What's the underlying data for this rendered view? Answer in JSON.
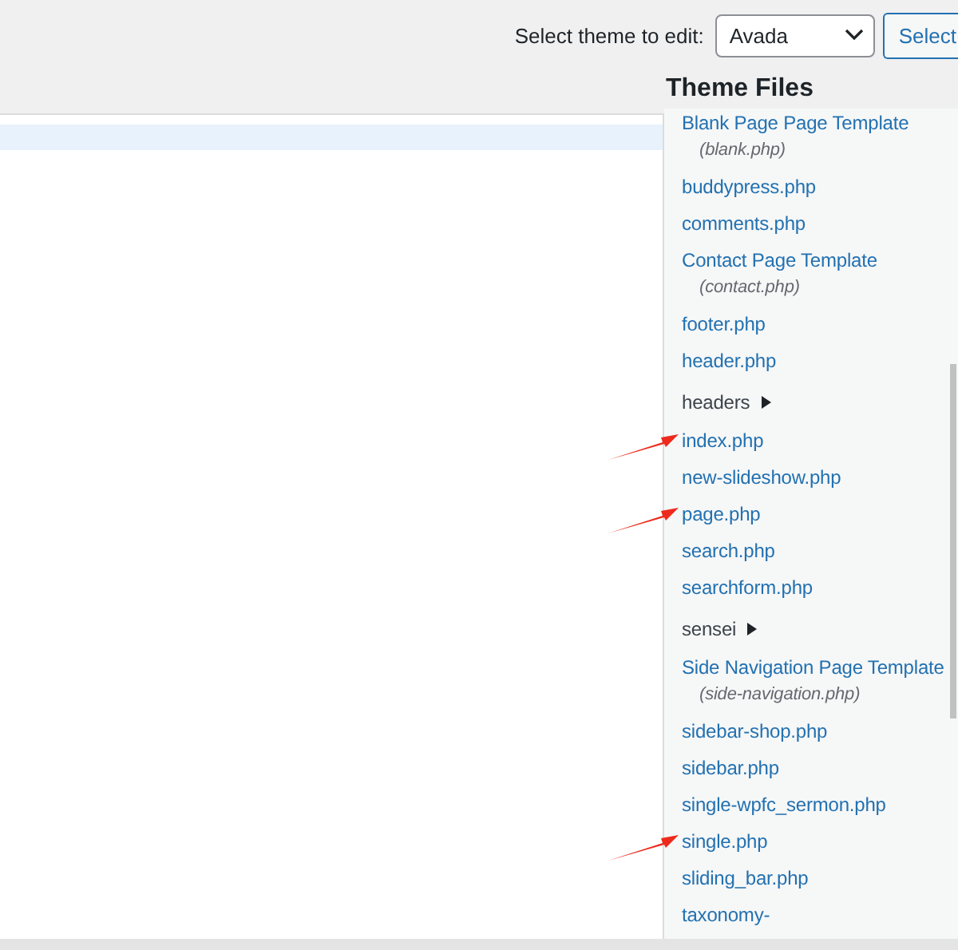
{
  "theme_selector": {
    "label": "Select theme to edit:",
    "value": "Avada",
    "button": "Select"
  },
  "editor": {
    "highlighted_line": true
  },
  "theme_files": {
    "title": "Theme Files",
    "items": [
      {
        "kind": "template",
        "name": "Blank Page Page Template",
        "file": "(blank.php)",
        "marked": false
      },
      {
        "kind": "file",
        "name": "buddypress.php",
        "marked": false
      },
      {
        "kind": "file",
        "name": "comments.php",
        "marked": false
      },
      {
        "kind": "template",
        "name": "Contact Page Template",
        "file": "(contact.php)",
        "marked": false
      },
      {
        "kind": "file",
        "name": "footer.php",
        "marked": false
      },
      {
        "kind": "file",
        "name": "header.php",
        "marked": false
      },
      {
        "kind": "folder",
        "name": "headers",
        "expanded": false,
        "marked": false
      },
      {
        "kind": "file",
        "name": "index.php",
        "marked": true
      },
      {
        "kind": "file",
        "name": "new-slideshow.php",
        "marked": false
      },
      {
        "kind": "file",
        "name": "page.php",
        "marked": true
      },
      {
        "kind": "file",
        "name": "search.php",
        "marked": false
      },
      {
        "kind": "file",
        "name": "searchform.php",
        "marked": false
      },
      {
        "kind": "folder",
        "name": "sensei",
        "expanded": false,
        "marked": false
      },
      {
        "kind": "template",
        "name": "Side Navigation Page Template",
        "file": "(side-navigation.php)",
        "marked": false
      },
      {
        "kind": "file",
        "name": "sidebar-shop.php",
        "marked": false
      },
      {
        "kind": "file",
        "name": "sidebar.php",
        "marked": false
      },
      {
        "kind": "file",
        "name": "single-wpfc_sermon.php",
        "marked": false
      },
      {
        "kind": "file",
        "name": "single.php",
        "marked": true
      },
      {
        "kind": "file",
        "name": "sliding_bar.php",
        "marked": false
      },
      {
        "kind": "file",
        "name": "taxonomy-",
        "marked": false
      }
    ]
  }
}
